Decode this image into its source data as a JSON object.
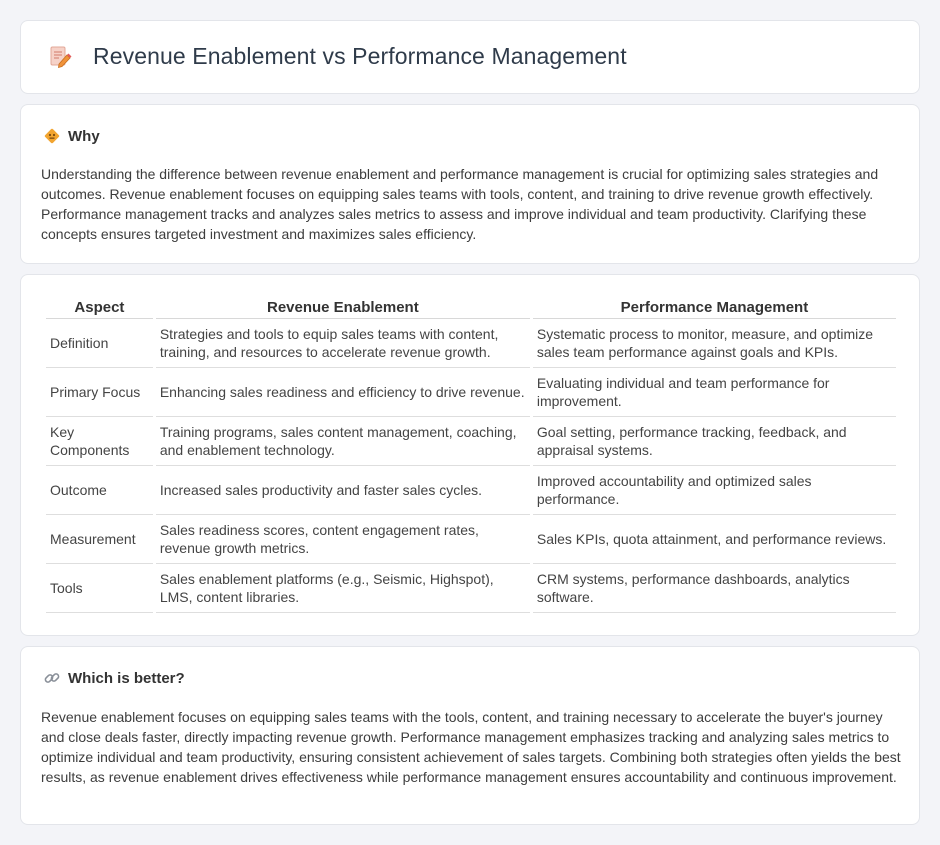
{
  "header": {
    "title": "Revenue Enablement vs Performance Management",
    "icon": "document-pencil-icon"
  },
  "why": {
    "title": "Why",
    "icon": "diamond-sign-icon",
    "text": "Understanding the difference between revenue enablement and performance management is crucial for optimizing sales strategies and outcomes. Revenue enablement focuses on equipping sales teams with tools, content, and training to drive revenue growth effectively. Performance management tracks and analyzes sales metrics to assess and improve individual and team productivity. Clarifying these concepts ensures targeted investment and maximizes sales efficiency."
  },
  "table": {
    "headers": [
      "Aspect",
      "Revenue Enablement",
      "Performance Management"
    ],
    "rows": [
      [
        "Definition",
        "Strategies and tools to equip sales teams with content, training, and resources to accelerate revenue growth.",
        "Systematic process to monitor, measure, and optimize sales team performance against goals and KPIs."
      ],
      [
        "Primary Focus",
        "Enhancing sales readiness and efficiency to drive revenue.",
        "Evaluating individual and team performance for improvement."
      ],
      [
        "Key Components",
        "Training programs, sales content management, coaching, and enablement technology.",
        "Goal setting, performance tracking, feedback, and appraisal systems."
      ],
      [
        "Outcome",
        "Increased sales productivity and faster sales cycles.",
        "Improved accountability and optimized sales performance."
      ],
      [
        "Measurement",
        "Sales readiness scores, content engagement rates, revenue growth metrics.",
        "Sales KPIs, quota attainment, and performance reviews."
      ],
      [
        "Tools",
        "Sales enablement platforms (e.g., Seismic, Highspot), LMS, content libraries.",
        "CRM systems, performance dashboards, analytics software."
      ]
    ]
  },
  "better": {
    "title": "Which is better?",
    "icon": "link-icon",
    "text": "Revenue enablement focuses on equipping sales teams with the tools, content, and training necessary to accelerate the buyer's journey and close deals faster, directly impacting revenue growth. Performance management emphasizes tracking and analyzing sales metrics to optimize individual and team productivity, ensuring consistent achievement of sales targets. Combining both strategies often yields the best results, as revenue enablement drives effectiveness while performance management ensures accountability and continuous improvement."
  },
  "colors": {
    "background": "#f3f4f8",
    "card": "#ffffff",
    "icon_accent": "#f0a030"
  }
}
